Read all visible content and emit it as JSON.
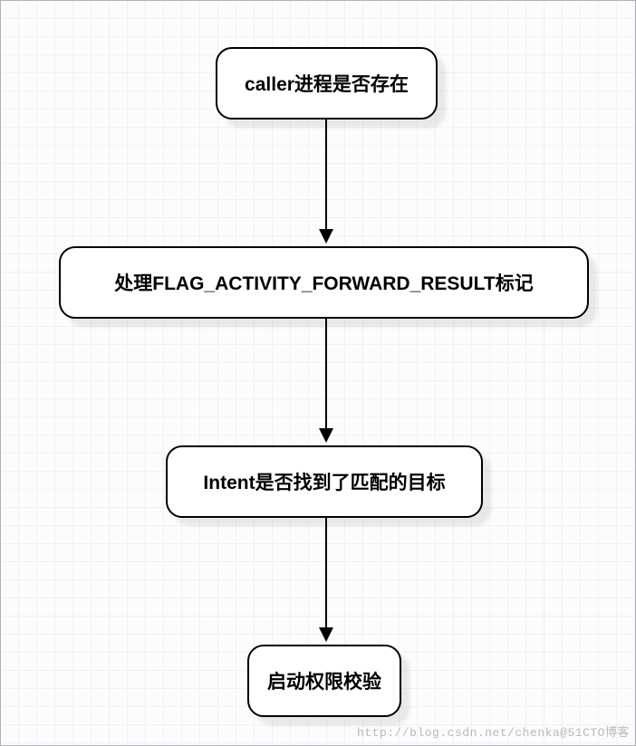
{
  "diagram": {
    "type": "flowchart",
    "direction": "top-to-bottom",
    "nodes": [
      {
        "id": "n1",
        "label": "caller进程是否存在"
      },
      {
        "id": "n2",
        "label": "处理FLAG_ACTIVITY_FORWARD_RESULT标记"
      },
      {
        "id": "n3",
        "label": "Intent是否找到了匹配的目标"
      },
      {
        "id": "n4",
        "label": "启动权限校验"
      }
    ],
    "edges": [
      {
        "from": "n1",
        "to": "n2"
      },
      {
        "from": "n2",
        "to": "n3"
      },
      {
        "from": "n3",
        "to": "n4"
      }
    ]
  },
  "watermark": "http://blog.csdn.net/chenka@51CTO博客"
}
